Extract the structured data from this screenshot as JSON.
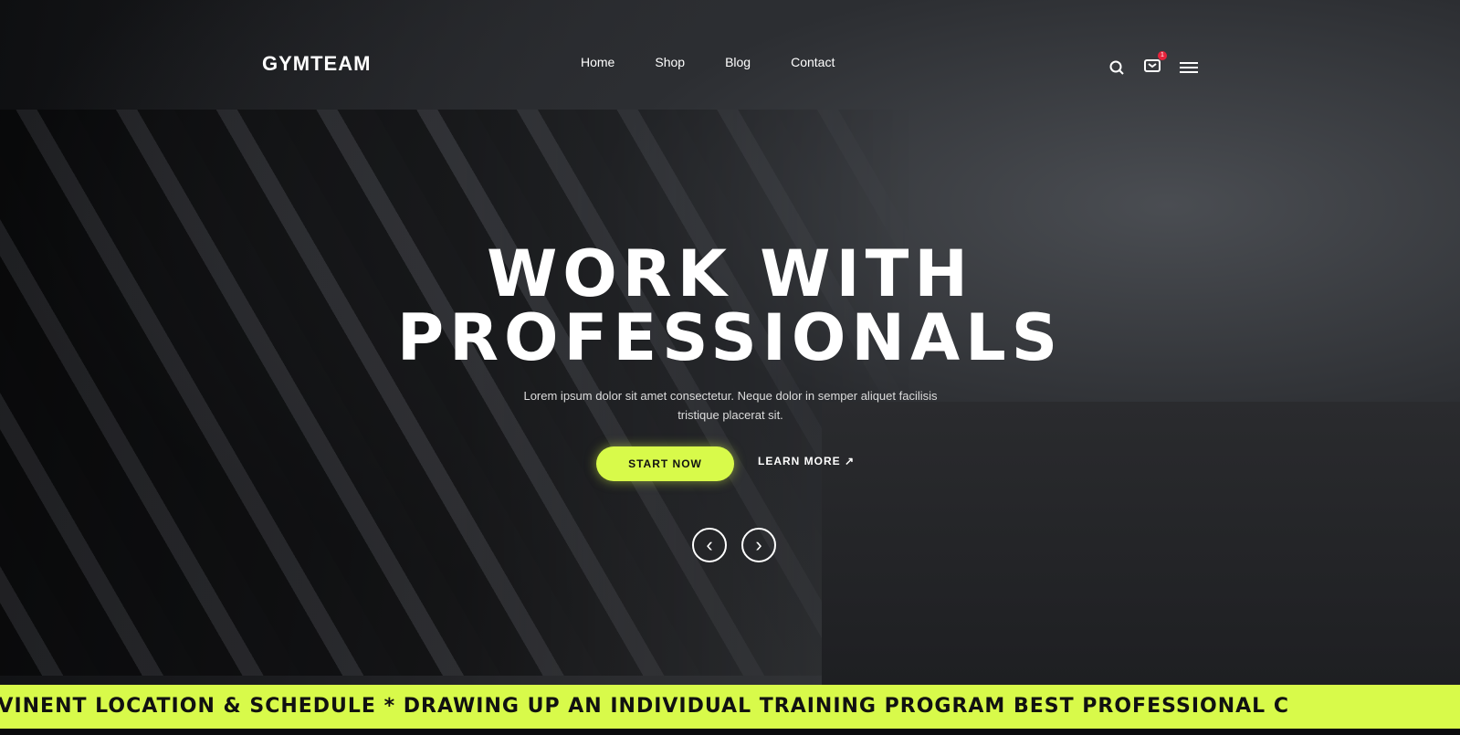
{
  "header": {
    "logo": "GYMTEAM",
    "nav": [
      "Home",
      "Shop",
      "Blog",
      "Contact"
    ],
    "cart_count": "1"
  },
  "hero": {
    "title_line1": "WORK WITH",
    "title_line2": "PROFESSIONALS",
    "subtitle": "Lorem ipsum dolor sit amet consectetur. Neque dolor in semper aliquet facilisis tristique placerat sit.",
    "start_label": "START NOW",
    "learn_label": "LEARN MORE ↗",
    "prev": "‹",
    "next": "›"
  },
  "marquee": {
    "text": "NVINENT LOCATION & SCHEDULE  *  DRAWING UP AN INDIVIDUAL TRAINING PROGRAM BEST PROFESSIONAL C"
  },
  "colors": {
    "accent": "#d8fa4a",
    "badge": "#e8243c"
  }
}
